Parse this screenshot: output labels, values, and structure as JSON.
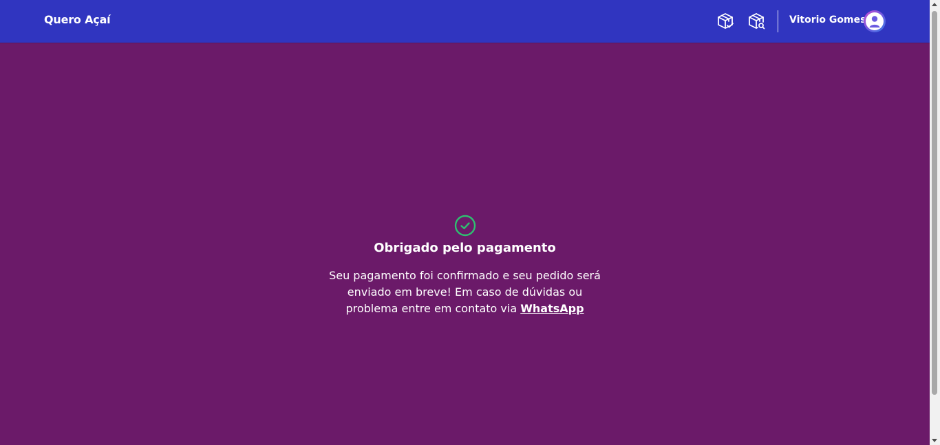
{
  "header": {
    "brand": "Quero Açaí",
    "icons": [
      {
        "name": "orders-box-check-icon"
      },
      {
        "name": "orders-box-search-icon"
      }
    ],
    "user": {
      "name": "Vitorio Gomes",
      "avatar_icon": "user-avatar-icon"
    },
    "bg_color": "#3035c0"
  },
  "page": {
    "bg_color": "#6b1a69"
  },
  "confirmation": {
    "icon": "check-circle-icon",
    "icon_color": "#2fbf71",
    "title": "Obrigado pelo pagamento",
    "message": "Seu pagamento foi confirmado e seu pedido será enviado em breve! Em caso de dúvidas ou problema entre em contato via",
    "link_label": "WhatsApp"
  }
}
